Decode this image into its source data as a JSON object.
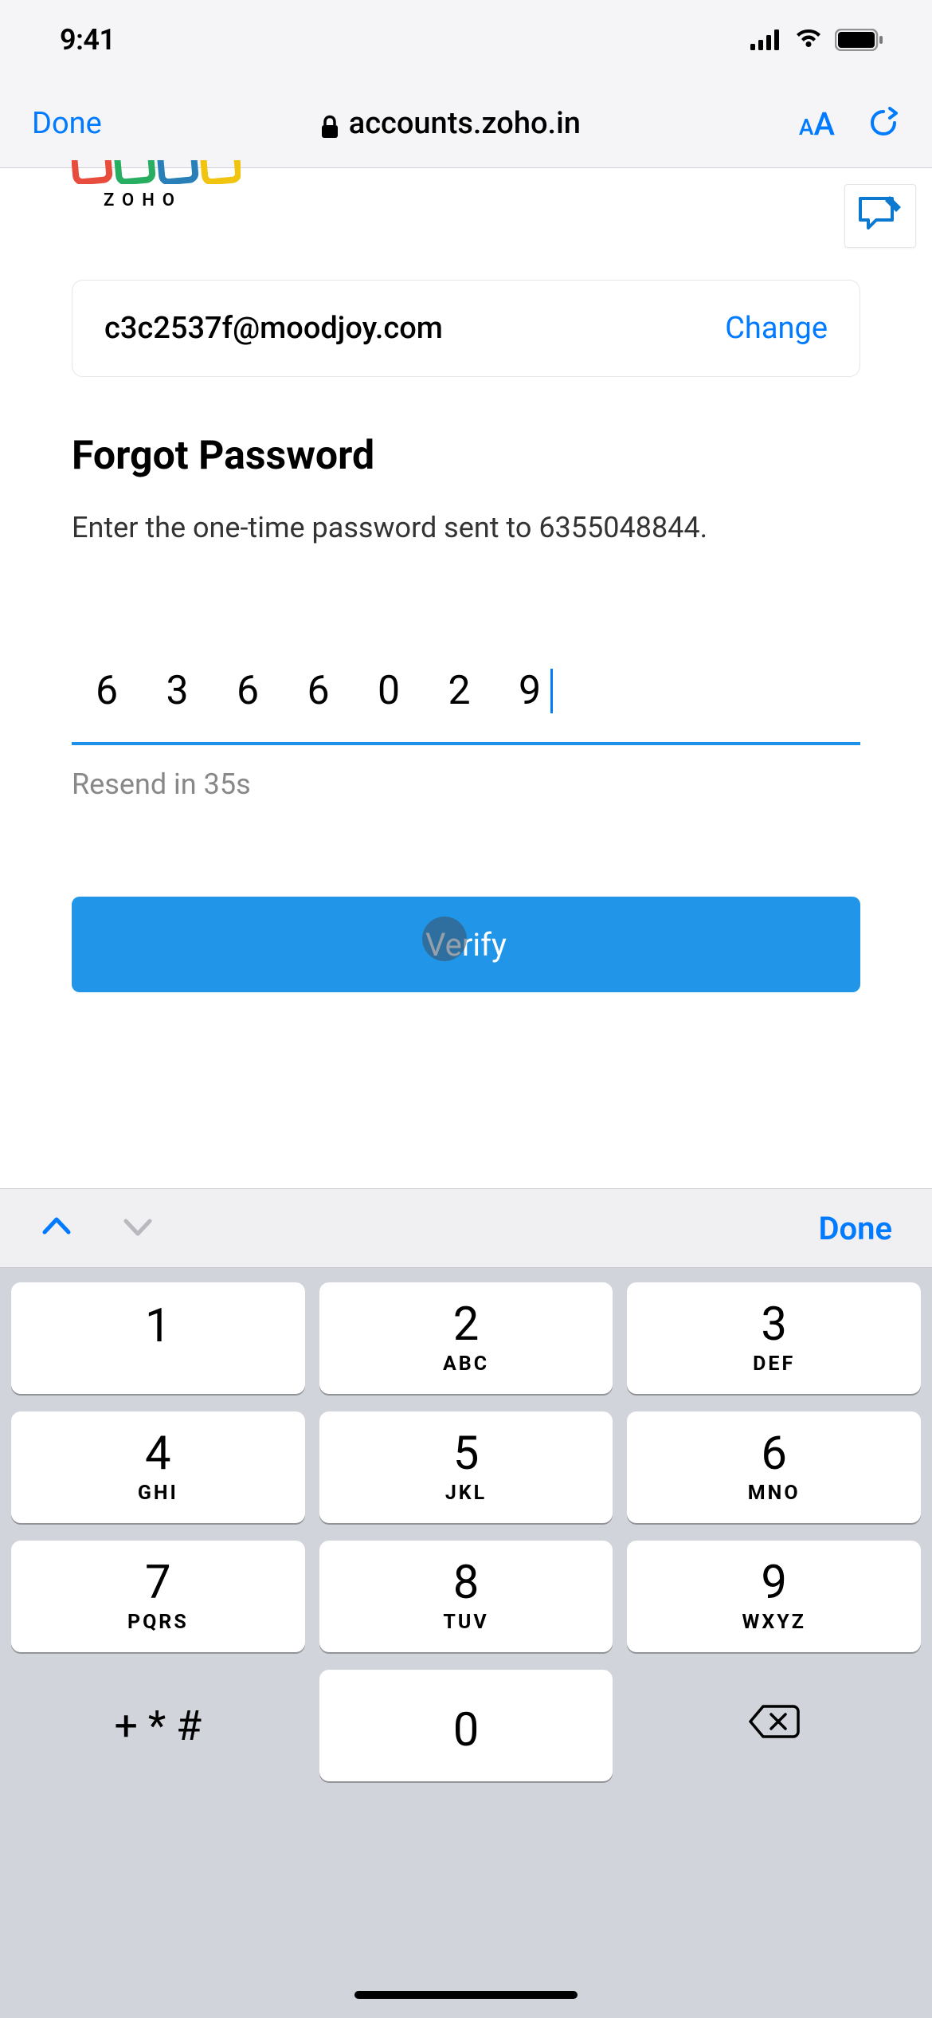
{
  "status": {
    "time": "9:41"
  },
  "browser": {
    "done_label": "Done",
    "url": "accounts.zoho.in"
  },
  "logo": {
    "brand_text": "ZOHO"
  },
  "account": {
    "email": "c3c2537f@moodjoy.com",
    "change_label": "Change"
  },
  "page": {
    "title": "Forgot Password",
    "instruction": "Enter the one-time password sent to 6355048844."
  },
  "otp": {
    "value": "6 3 6 6 0 2 9",
    "resend_text": "Resend in 35s"
  },
  "actions": {
    "verify_label": "Verify"
  },
  "keyboard_accessory": {
    "done_label": "Done"
  },
  "keypad": {
    "keys": [
      [
        {
          "num": "1",
          "letters": ""
        },
        {
          "num": "2",
          "letters": "ABC"
        },
        {
          "num": "3",
          "letters": "DEF"
        }
      ],
      [
        {
          "num": "4",
          "letters": "GHI"
        },
        {
          "num": "5",
          "letters": "JKL"
        },
        {
          "num": "6",
          "letters": "MNO"
        }
      ],
      [
        {
          "num": "7",
          "letters": "PQRS"
        },
        {
          "num": "8",
          "letters": "TUV"
        },
        {
          "num": "9",
          "letters": "WXYZ"
        }
      ],
      [
        {
          "special": "+ * #"
        },
        {
          "num": "0",
          "letters": ""
        },
        {
          "backspace": true
        }
      ]
    ]
  }
}
